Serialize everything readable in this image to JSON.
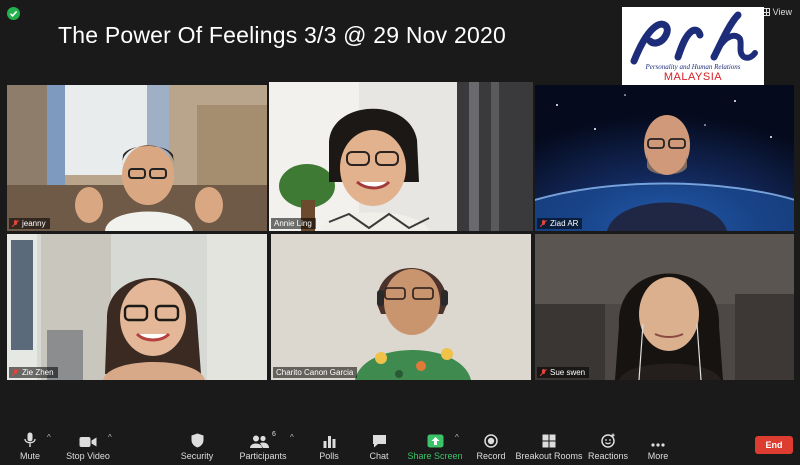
{
  "meeting": {
    "title": "The Power Of Feelings 3/3 @ 29 Nov 2020",
    "view_label": "View"
  },
  "logo": {
    "letters": "prh",
    "tagline": "Personality and Human Relations",
    "country": "MALAYSIA",
    "colors": {
      "ink": "#1d2d7a",
      "country": "#d31f26"
    }
  },
  "participants": [
    {
      "name": "jeanny",
      "muted": true,
      "active": false
    },
    {
      "name": "Annie Ling",
      "muted": false,
      "active": true
    },
    {
      "name": "Ziad AR",
      "muted": true,
      "active": false
    },
    {
      "name": "Zie Zhen",
      "muted": true,
      "active": false
    },
    {
      "name": "Charito Canon Garcia",
      "muted": false,
      "active": false
    },
    {
      "name": "Sue swen",
      "muted": true,
      "active": false
    }
  ],
  "toolbar": {
    "mute": "Mute",
    "stop_video": "Stop Video",
    "security": "Security",
    "participants": "Participants",
    "participants_count": "6",
    "polls": "Polls",
    "chat": "Chat",
    "share_screen": "Share Screen",
    "record": "Record",
    "breakout_rooms": "Breakout Rooms",
    "reactions": "Reactions",
    "more": "More",
    "end": "End"
  },
  "colors": {
    "active_speaker_border": "#e5e246",
    "share_green": "#3cc36a",
    "end_red": "#dd3d31",
    "muted_red": "#e0453b"
  }
}
